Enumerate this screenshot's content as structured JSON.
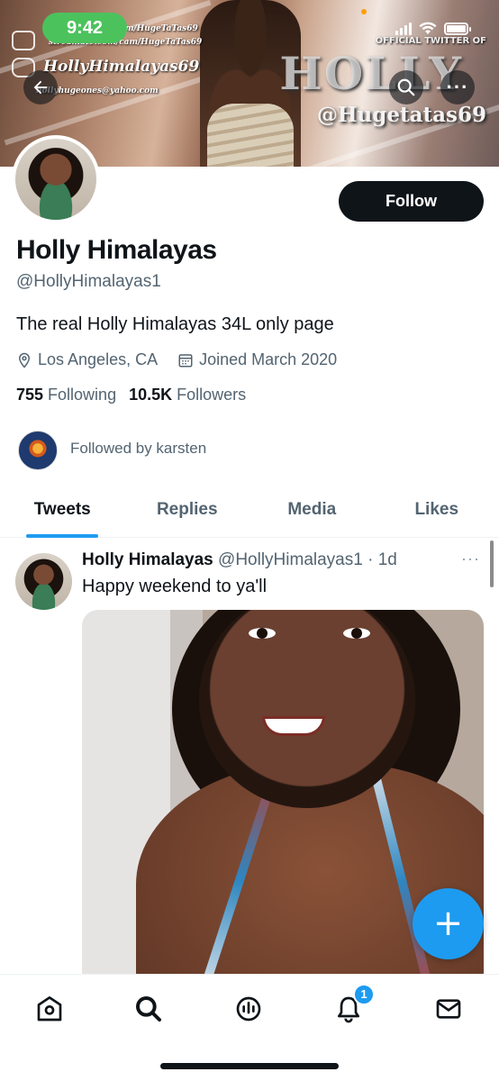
{
  "status_bar": {
    "time": "9:42"
  },
  "banner": {
    "url_line1": "f...om/HugeTaTas69",
    "url_line2": "streamate.com/cam/HugeTaTas69",
    "instagram": "HollyHimalayas69",
    "email": "hollyhugeones@yahoo.com",
    "official": "OFFICIAL TWITTER OF",
    "holly": "HOLLY",
    "handle": "@Hugetatas69"
  },
  "profile": {
    "follow_label": "Follow",
    "name": "Holly Himalayas",
    "handle": "@HollyHimalayas1",
    "bio": "The real Holly Himalayas 34L only page",
    "location": "Los Angeles, CA",
    "joined": "Joined March 2020",
    "following_count": "755",
    "following_label": "Following",
    "followers_count": "10.5K",
    "followers_label": "Followers",
    "followed_by": "Followed by karsten"
  },
  "tabs": [
    {
      "label": "Tweets",
      "active": true
    },
    {
      "label": "Replies",
      "active": false
    },
    {
      "label": "Media",
      "active": false
    },
    {
      "label": "Likes",
      "active": false
    }
  ],
  "tweet": {
    "author": "Holly Himalayas",
    "meta": "@HollyHimalayas1 · 1d",
    "more": "···",
    "text": "Happy weekend to ya'll"
  },
  "fab_label": "+",
  "bottom_nav": {
    "items": [
      "home-icon",
      "search-icon",
      "spaces-icon",
      "notifications-icon",
      "messages-icon"
    ],
    "notification_badge": "1"
  },
  "colors": {
    "accent": "#1d9bf0",
    "text": "#0f1419",
    "secondary": "#536471",
    "time_pill": "#4cc25d"
  }
}
